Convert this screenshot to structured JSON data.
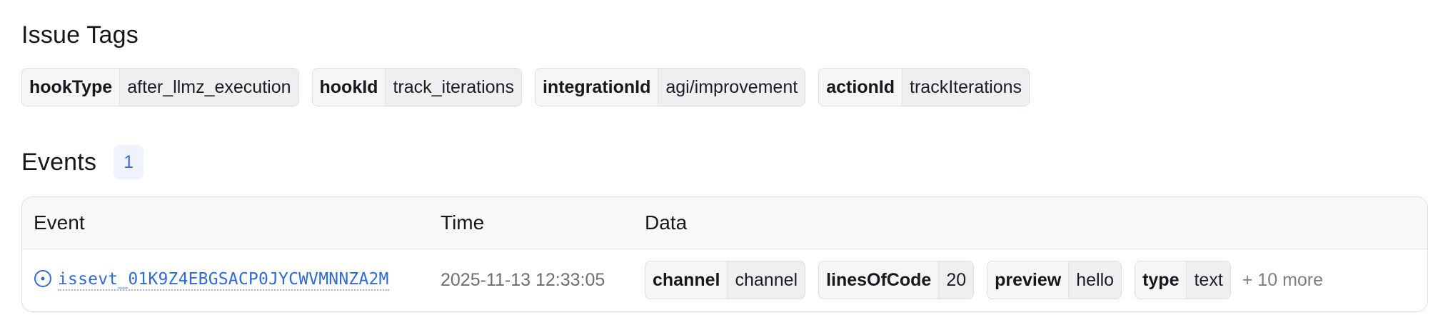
{
  "issue_tags": {
    "title": "Issue Tags",
    "tags": [
      {
        "key": "hookType",
        "value": "after_llmz_execution"
      },
      {
        "key": "hookId",
        "value": "track_iterations"
      },
      {
        "key": "integrationId",
        "value": "agi/improvement"
      },
      {
        "key": "actionId",
        "value": "trackIterations"
      }
    ]
  },
  "events": {
    "title": "Events",
    "count": "1",
    "columns": {
      "event": "Event",
      "time": "Time",
      "data": "Data"
    },
    "rows": [
      {
        "icon": "circle-dot-icon",
        "event_id": "issevt_01K9Z4EBGSACP0JYCWVMNNZA2M",
        "time": "2025-11-13 12:33:05",
        "data": [
          {
            "key": "channel",
            "value": "channel"
          },
          {
            "key": "linesOfCode",
            "value": "20"
          },
          {
            "key": "preview",
            "value": "hello"
          },
          {
            "key": "type",
            "value": "text"
          }
        ],
        "more": "+ 10 more"
      }
    ]
  },
  "colors": {
    "link": "#2f6bd3",
    "badge_bg": "#eef3fd",
    "badge_text": "#3a6fd8"
  }
}
